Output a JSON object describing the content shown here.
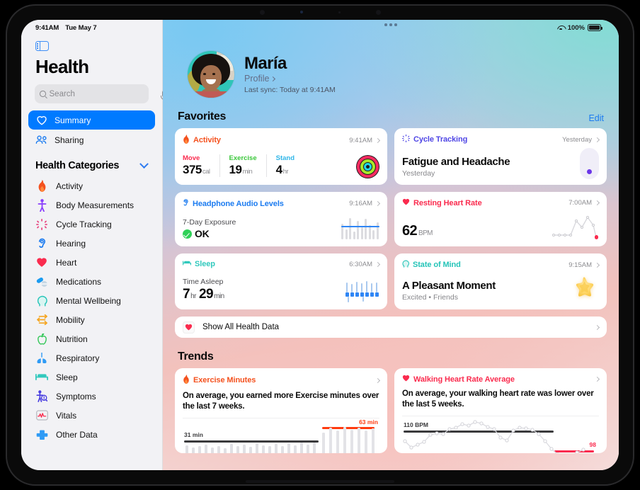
{
  "status_bar": {
    "time": "9:41AM",
    "date": "Tue May 7",
    "battery_pct": "100%",
    "wifi_icon": "wifi-icon",
    "battery_icon": "battery-icon"
  },
  "sidebar": {
    "toggle_icon": "sidebar-toggle-icon",
    "app_title": "Health",
    "search": {
      "placeholder": "Search",
      "value": "",
      "icon": "search-icon",
      "mic_icon": "microphone-icon"
    },
    "nav": [
      {
        "label": "Summary",
        "icon": "heart-outline-icon",
        "active": true
      },
      {
        "label": "Sharing",
        "icon": "people-icon",
        "active": false
      }
    ],
    "categories_header": {
      "label": "Health Categories",
      "chevron_icon": "chevron-down-icon"
    },
    "categories": [
      {
        "label": "Activity",
        "icon": "flame-icon",
        "color": "#f4511e"
      },
      {
        "label": "Body Measurements",
        "icon": "body-icon",
        "color": "#8a3ffc"
      },
      {
        "label": "Cycle Tracking",
        "icon": "cycle-icon",
        "color": "#e8437e"
      },
      {
        "label": "Hearing",
        "icon": "ear-icon",
        "color": "#1b7bf0"
      },
      {
        "label": "Heart",
        "icon": "heart-icon",
        "color": "#fa2b4e"
      },
      {
        "label": "Medications",
        "icon": "pills-icon",
        "color": "#1b9bf0"
      },
      {
        "label": "Mental Wellbeing",
        "icon": "head-icon",
        "color": "#25c4b8"
      },
      {
        "label": "Mobility",
        "icon": "mobility-arrows-icon",
        "color": "#f5a623"
      },
      {
        "label": "Nutrition",
        "icon": "apple-icon",
        "color": "#34c759"
      },
      {
        "label": "Respiratory",
        "icon": "lungs-icon",
        "color": "#2f9bf5"
      },
      {
        "label": "Sleep",
        "icon": "bed-icon",
        "color": "#31c9bd"
      },
      {
        "label": "Symptoms",
        "icon": "symptoms-icon",
        "color": "#4a3fe0"
      },
      {
        "label": "Vitals",
        "icon": "vitals-waveform-icon",
        "color": "#fa2b4e"
      },
      {
        "label": "Other Data",
        "icon": "cross-icon",
        "color": "#2f9bf5"
      }
    ]
  },
  "profile": {
    "avatar_icon": "user-avatar",
    "name": "María",
    "profile_link": "Profile",
    "profile_chevron_icon": "chevron-right-icon",
    "last_sync": "Last sync: Today at 9:41AM"
  },
  "favorites": {
    "title": "Favorites",
    "edit_label": "Edit",
    "cards": {
      "activity": {
        "title": "Activity",
        "icon": "flame-icon",
        "color": "#f4511e",
        "time": "9:41AM",
        "rings_icon": "activity-rings-icon",
        "stats": [
          {
            "label": "Move",
            "value": "375",
            "unit": "cal",
            "color": "#fa2b4e"
          },
          {
            "label": "Exercise",
            "value": "19",
            "unit": "min",
            "color": "#3bc73b"
          },
          {
            "label": "Stand",
            "value": "4",
            "unit": "hr",
            "color": "#2fb6e8"
          }
        ]
      },
      "cycle": {
        "title": "Cycle Tracking",
        "icon": "cycle-icon",
        "color": "#4f46e5",
        "time": "Yesterday",
        "headline": "Fatigue and Headache",
        "subline": "Yesterday",
        "dot_color": "#6b36e8"
      },
      "headphone": {
        "title": "Headphone Audio Levels",
        "icon": "headphone-icon",
        "color": "#1b7bf0",
        "time": "9:16AM",
        "lead": "7-Day Exposure",
        "status": "OK",
        "status_icon": "check-circle-icon",
        "status_color": "#30d158",
        "chart": {
          "type": "bar",
          "values": [
            22,
            14,
            30,
            11,
            26,
            17,
            29,
            20,
            13,
            24
          ],
          "avg_line": true
        }
      },
      "resting_heart": {
        "title": "Resting Heart Rate",
        "icon": "heart-icon",
        "color": "#fa2b4e",
        "time": "7:00AM",
        "value": "62",
        "unit": "BPM",
        "chart": {
          "type": "line",
          "values": [
            30,
            30,
            30,
            30,
            12,
            20,
            6,
            16,
            34
          ]
        }
      },
      "sleep": {
        "title": "Sleep",
        "icon": "bed-icon",
        "color": "#31c9bd",
        "time": "6:30AM",
        "lead": "Time Asleep",
        "hours": "7",
        "hours_unit": "hr",
        "minutes": "29",
        "minutes_unit": "min"
      },
      "state_of_mind": {
        "title": "State of Mind",
        "icon": "head-icon",
        "color": "#25c4b8",
        "time": "9:15AM",
        "headline": "A Pleasant Moment",
        "subline": "Excited • Friends",
        "star_icon": "star-icon"
      }
    },
    "show_all": {
      "label": "Show All Health Data",
      "icon": "heart-icon",
      "chevron_icon": "chevron-right-icon"
    }
  },
  "trends": {
    "title": "Trends",
    "cards": [
      {
        "title": "Exercise Minutes",
        "icon": "flame-icon",
        "color": "#f4511e",
        "description": "On average, you earned more Exercise minutes over the last 7 weeks.",
        "baseline_label": "31 min",
        "current_label": "63 min",
        "baseline_color": "#3a3a3c",
        "current_color": "#ff3b0f"
      },
      {
        "title": "Walking Heart Rate Average",
        "icon": "heart-icon",
        "color": "#fa2b4e",
        "description": "On average, your walking heart rate was lower over the last 5 weeks.",
        "baseline_label": "110 BPM",
        "current_label": "98",
        "baseline_color": "#3a3a3c",
        "current_color": "#fa2b4e"
      }
    ]
  },
  "chart_data": [
    {
      "type": "bar",
      "title": "Exercise Minutes",
      "ylabel": "minutes",
      "baseline": 31,
      "baseline_label": "31 min",
      "current": 63,
      "current_label": "63 min",
      "annotation": "On average, you earned more Exercise minutes over the last 7 weeks.",
      "values": [
        22,
        20,
        21,
        23,
        20,
        22,
        19,
        24,
        22,
        23,
        21,
        25,
        23,
        22,
        24,
        22,
        25,
        23,
        26,
        24,
        27,
        25,
        28,
        45,
        52,
        48,
        55,
        50,
        53,
        49,
        52
      ],
      "baseline_span": [
        0,
        22
      ],
      "current_span": [
        23,
        30
      ]
    },
    {
      "type": "line",
      "title": "Walking Heart Rate Average",
      "ylabel": "BPM",
      "baseline": 110,
      "baseline_label": "110 BPM",
      "current": 98,
      "current_label": "98",
      "annotation": "On average, your walking heart rate was lower over the last 5 weeks.",
      "values": [
        104,
        97,
        99,
        102,
        107,
        109,
        108,
        112,
        113,
        116,
        115,
        118,
        117,
        114,
        112,
        106,
        104,
        110,
        113,
        112,
        111,
        108,
        103,
        98,
        95,
        94,
        95,
        97,
        99
      ],
      "baseline_span": [
        0,
        22
      ],
      "current_span": [
        23,
        28
      ]
    }
  ]
}
